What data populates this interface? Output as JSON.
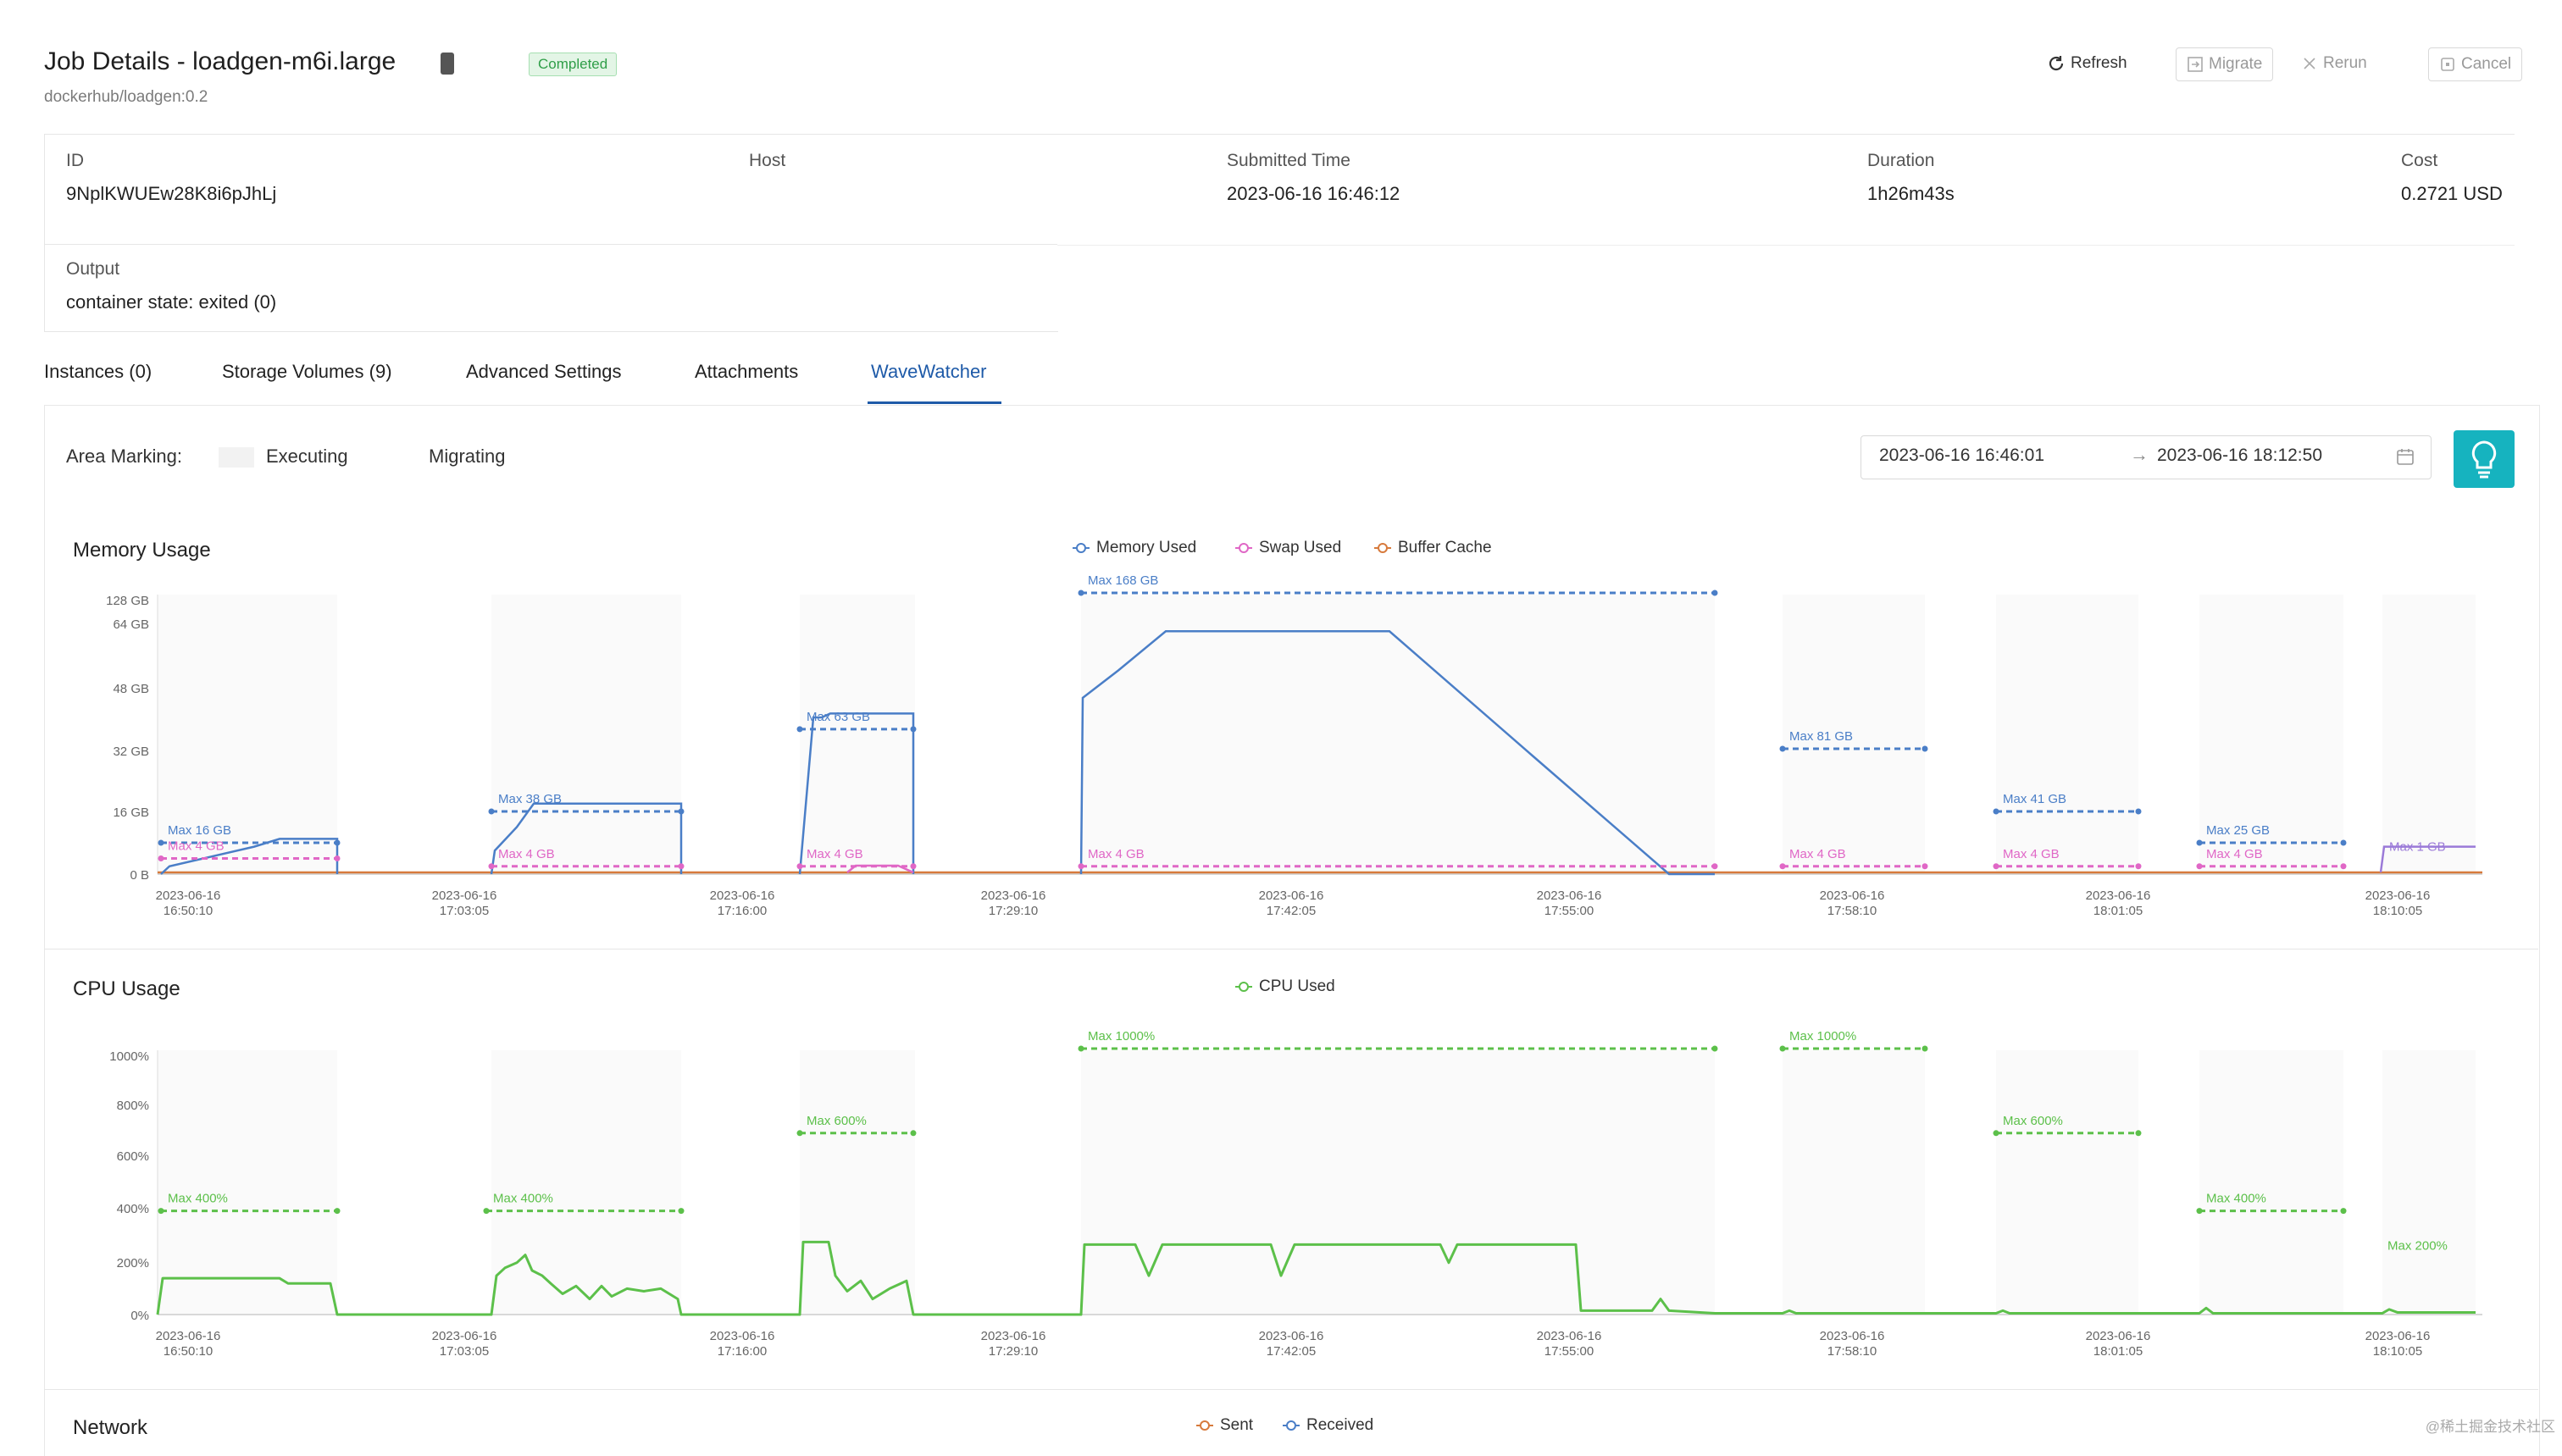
{
  "header": {
    "title": "Job Details - loadgen-m6i.large",
    "badge_dark": "",
    "badge_status": "Completed",
    "subtitle": "dockerhub/loadgen:0.2",
    "buttons": {
      "refresh": "Refresh",
      "migrate": "Migrate",
      "rerun": "Rerun",
      "cancel": "Cancel"
    }
  },
  "info": {
    "id_label": "ID",
    "id_value": "9NplKWUEw28K8i6pJhLj",
    "host_label": "Host",
    "host_value": "",
    "submitted_label": "Submitted Time",
    "submitted_value": "2023-06-16 16:46:12",
    "duration_label": "Duration",
    "duration_value": "1h26m43s",
    "cost_label": "Cost",
    "cost_value": "0.2721 USD",
    "output_label": "Output",
    "output_value": "container state: exited (0)"
  },
  "tabs": [
    "Instances (0)",
    "Storage Volumes (9)",
    "Advanced Settings",
    "Attachments",
    "WaveWatcher"
  ],
  "active_tab": 4,
  "controls": {
    "area_marking_label": "Area Marking:",
    "executing_label": "Executing",
    "migrating_label": "Migrating",
    "range_start": "2023-06-16 16:46:01",
    "range_arrow": "→",
    "range_end": "2023-06-16 18:12:50"
  },
  "colors": {
    "memory_used": "#4a7ec7",
    "swap_used": "#e067c6",
    "buffer_cache": "#d77a3c",
    "cpu_used": "#5cc04a",
    "sent": "#d77a3c",
    "received": "#4a7ec7",
    "accent": "#1e5aa8",
    "bulb_button": "#16b3bf",
    "status_green": "#2f9e48"
  },
  "memory_chart": {
    "title": "Memory Usage",
    "legend": [
      "Memory Used",
      "Swap Used",
      "Buffer Cache"
    ],
    "y_ticks": [
      "0 B",
      "16 GB",
      "32 GB",
      "48 GB",
      "64 GB",
      "128 GB"
    ],
    "x_ticks": [
      [
        "2023-06-16",
        "16:50:10"
      ],
      [
        "2023-06-16",
        "17:03:05"
      ],
      [
        "2023-06-16",
        "17:16:00"
      ],
      [
        "2023-06-16",
        "17:29:10"
      ],
      [
        "2023-06-16",
        "17:42:05"
      ],
      [
        "2023-06-16",
        "17:55:00"
      ],
      [
        "2023-06-16",
        "17:58:10"
      ],
      [
        "2023-06-16",
        "18:01:05"
      ],
      [
        "2023-06-16",
        "18:10:05"
      ]
    ],
    "max_labels": [
      "Max 16 GB",
      "Max 4 GB",
      "Max 38 GB",
      "Max 4 GB",
      "Max 63 GB",
      "Max 4 GB",
      "Max 168 GB",
      "Max 4 GB",
      "Max 81 GB",
      "Max 4 GB",
      "Max 41 GB",
      "Max 4 GB",
      "Max 25 GB",
      "Max 4 GB",
      "Max 1 GB"
    ]
  },
  "cpu_chart": {
    "title": "CPU Usage",
    "legend": [
      "CPU Used"
    ],
    "y_ticks": [
      "0%",
      "200%",
      "400%",
      "600%",
      "800%",
      "1000%"
    ],
    "x_ticks": [
      [
        "2023-06-16",
        "16:50:10"
      ],
      [
        "2023-06-16",
        "17:03:05"
      ],
      [
        "2023-06-16",
        "17:16:00"
      ],
      [
        "2023-06-16",
        "17:29:10"
      ],
      [
        "2023-06-16",
        "17:42:05"
      ],
      [
        "2023-06-16",
        "17:55:00"
      ],
      [
        "2023-06-16",
        "17:58:10"
      ],
      [
        "2023-06-16",
        "18:01:05"
      ],
      [
        "2023-06-16",
        "18:10:05"
      ]
    ],
    "max_labels": [
      "Max 400%",
      "Max 400%",
      "Max 600%",
      "Max 1000%",
      "Max 1000%",
      "Max 600%",
      "Max 400%",
      "Max 200%"
    ]
  },
  "network_chart": {
    "title": "Network",
    "legend": [
      "Sent",
      "Received"
    ]
  },
  "watermark": "@稀土掘金技术社区"
}
